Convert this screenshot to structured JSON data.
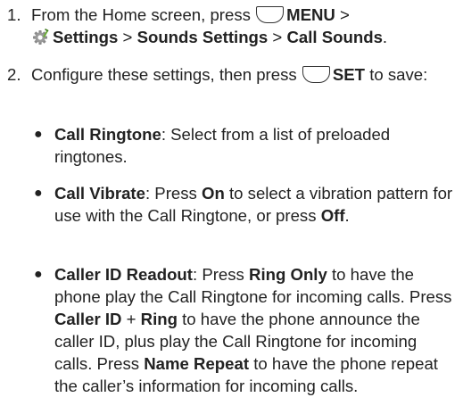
{
  "step1": {
    "number": "1.",
    "intro": "From the Home screen, press",
    "menu_key": "MENU",
    "sep1": " >",
    "settings": "Settings",
    "sep2": " > ",
    "sounds_settings": "Sounds Settings",
    "sep3": " > ",
    "call_sounds": "Call Sounds",
    "end": "."
  },
  "step2": {
    "number": "2.",
    "intro": "Configure these settings, then press",
    "set_key": "SET",
    "outro": " to save:"
  },
  "bullets": [
    {
      "title": "Call Ringtone",
      "segments": [
        ": Select from a list of preloaded ringtones."
      ]
    },
    {
      "title": "Call Vibrate",
      "segments": [
        ": Press ",
        "On",
        " to select a vibration pattern for use with the Call Ringtone, or press ",
        "Off",
        "."
      ]
    },
    {
      "title": "Caller ID Readout",
      "segments": [
        ": Press ",
        "Ring Only",
        " to have the phone play the Call Ringtone for incoming calls. Press ",
        "Caller ID",
        " + ",
        "Ring",
        " to have the phone announce the caller ID, plus play the Call Ringtone for incoming calls. Press ",
        "Name Repeat",
        " to have the phone repeat the caller’s information for incoming calls."
      ]
    }
  ]
}
